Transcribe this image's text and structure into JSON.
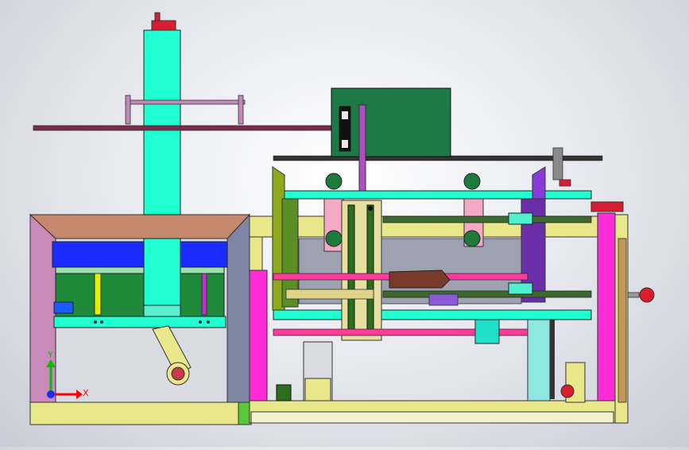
{
  "viewport": {
    "triad": {
      "x_label": "X",
      "y_label": "Y"
    },
    "colors": {
      "cyan": "#1fffd2",
      "magenta": "#ff2bd6",
      "pink": "#ff3a9a",
      "green_box": "#1b7a45",
      "dark_green": "#2a6e1e",
      "olive": "#8fa91f",
      "yellow_pale": "#e8e88a",
      "blue": "#1a2bff",
      "brown_top": "#c58a6e",
      "mauve": "#c08ab8",
      "gray_blue": "#7f88a8",
      "red_handwheel": "#d81e2e",
      "axis_x": "#ff0000",
      "axis_y": "#00c000"
    }
  }
}
